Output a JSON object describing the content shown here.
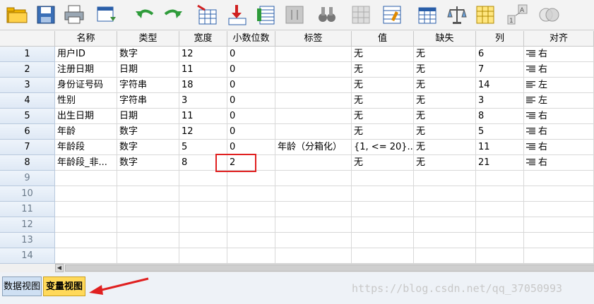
{
  "toolbar": {
    "icons": [
      "open-folder-icon",
      "save-icon",
      "print-icon",
      "dialog-recall-icon",
      "undo-icon",
      "redo-icon",
      "goto-case-icon",
      "goto-variable-icon",
      "variables-icon",
      "find-icon",
      "binoculars-icon",
      "insert-case-icon",
      "insert-variable-icon",
      "split-file-icon",
      "weight-cases-icon",
      "select-cases-icon",
      "value-labels-icon",
      "use-sets-icon"
    ]
  },
  "columns": [
    "名称",
    "类型",
    "宽度",
    "小数位数",
    "标签",
    "值",
    "缺失",
    "列",
    "对齐"
  ],
  "rows": [
    {
      "num": "1",
      "name": "用户ID",
      "type": "数字",
      "width": "12",
      "decimals": "0",
      "label": "",
      "values": "无",
      "missing": "无",
      "columns": "6",
      "align": "右"
    },
    {
      "num": "2",
      "name": "注册日期",
      "type": "日期",
      "width": "11",
      "decimals": "0",
      "label": "",
      "values": "无",
      "missing": "无",
      "columns": "7",
      "align": "右"
    },
    {
      "num": "3",
      "name": "身份证号码",
      "type": "字符串",
      "width": "18",
      "decimals": "0",
      "label": "",
      "values": "无",
      "missing": "无",
      "columns": "14",
      "align": "左"
    },
    {
      "num": "4",
      "name": "性别",
      "type": "字符串",
      "width": "3",
      "decimals": "0",
      "label": "",
      "values": "无",
      "missing": "无",
      "columns": "3",
      "align": "左"
    },
    {
      "num": "5",
      "name": "出生日期",
      "type": "日期",
      "width": "11",
      "decimals": "0",
      "label": "",
      "values": "无",
      "missing": "无",
      "columns": "8",
      "align": "右"
    },
    {
      "num": "6",
      "name": "年龄",
      "type": "数字",
      "width": "12",
      "decimals": "0",
      "label": "",
      "values": "无",
      "missing": "无",
      "columns": "5",
      "align": "右"
    },
    {
      "num": "7",
      "name": "年龄段",
      "type": "数字",
      "width": "5",
      "decimals": "0",
      "label": "年龄（分箱化）",
      "values": "{1, <= 20}...",
      "missing": "无",
      "columns": "11",
      "align": "右"
    },
    {
      "num": "8",
      "name": "年龄段_非...",
      "type": "数字",
      "width": "8",
      "decimals": "2",
      "label": "",
      "values": "无",
      "missing": "无",
      "columns": "21",
      "align": "右"
    }
  ],
  "empty_rows": [
    "9",
    "10",
    "11",
    "12",
    "13",
    "14"
  ],
  "tabs": {
    "data_view": "数据视图",
    "variable_view": "变量视图"
  },
  "watermark": "https://blog.csdn.net/qq_37050993",
  "colors": {
    "highlight": "#e02020",
    "active_tab": "#ffd95a",
    "row_header": "#dfe9f5"
  }
}
